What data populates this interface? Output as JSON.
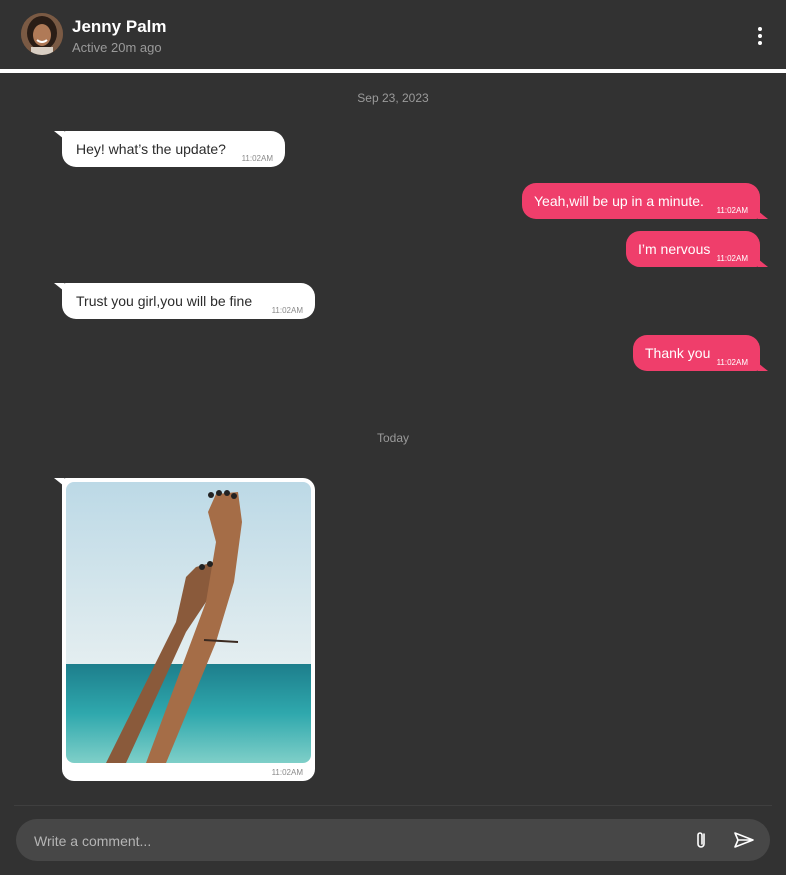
{
  "header": {
    "name": "Jenny Palm",
    "status": "Active 20m ago"
  },
  "messages": {
    "date1": "Sep 23, 2023",
    "m1": {
      "text": "Hey! what’s the update?",
      "time": "11:02AM"
    },
    "m2": {
      "text": "Yeah,will be up in a minute.",
      "time": "11:02AM"
    },
    "m3": {
      "text": "I’m nervous",
      "time": "11:02AM"
    },
    "m4": {
      "text": "Trust you girl,you will be fine",
      "time": "11:02AM"
    },
    "m5": {
      "text": "Thank you",
      "time": "11:02AM"
    },
    "date2": "Today",
    "m6": {
      "time": "11:02AM"
    }
  },
  "composer": {
    "placeholder": "Write a comment..."
  },
  "colors": {
    "background": "#323232",
    "accent": "#ef3e6b",
    "incoming": "#ffffff"
  },
  "icons": [
    "more-vertical-icon",
    "paperclip-icon",
    "send-icon"
  ]
}
